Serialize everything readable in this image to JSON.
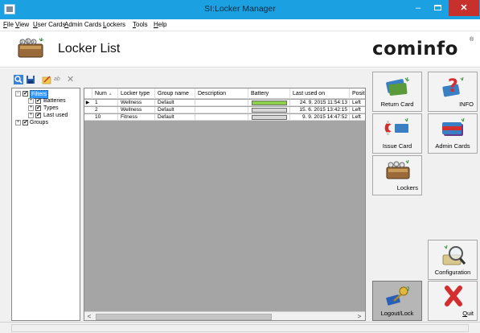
{
  "window": {
    "title": "SI:Locker Manager",
    "buttons": {
      "minimize": "–",
      "close": "✕"
    }
  },
  "menu": {
    "items": [
      "File",
      "View",
      "User Cards",
      "Admin Cards",
      "Lockers",
      "Tools",
      "Help"
    ]
  },
  "header": {
    "title": "Locker List",
    "logo": "cominfo",
    "logo_mark": "®"
  },
  "toolbar": {
    "icons": [
      "search-icon",
      "save-icon",
      "edit-icon",
      "rename-icon",
      "delete-icon"
    ],
    "rename_glyph": "ab",
    "delete_glyph": "✕"
  },
  "tree": {
    "nodes": [
      {
        "label": "Filters",
        "expander": "−",
        "selected": true
      },
      {
        "label": "Batteries",
        "expander": "+"
      },
      {
        "label": "Types",
        "expander": "+"
      },
      {
        "label": "Last used",
        "expander": "+"
      },
      {
        "label": "Groups",
        "expander": "+"
      }
    ]
  },
  "grid": {
    "columns": [
      "Num",
      "Locker type",
      "Group name",
      "Description",
      "Battery",
      "Last used on",
      "Positi"
    ],
    "sort_glyph": "▲",
    "current_row_marker": "▶",
    "rows": [
      {
        "num": "1",
        "type": "Wellness",
        "group": "Default",
        "description": "",
        "battery_level": 1.0,
        "last_used": "24. 9. 2015 11:54:13",
        "position": "Left"
      },
      {
        "num": "2",
        "type": "Wellness",
        "group": "Default",
        "description": "",
        "battery_level": 0.0,
        "last_used": "15. 6. 2015 13:42:15",
        "position": "Left"
      },
      {
        "num": "10",
        "type": "Fitness",
        "group": "Default",
        "description": "",
        "battery_level": 0.0,
        "last_used": "9. 9. 2015 14:47:52",
        "position": "Left"
      }
    ],
    "scroll_left": "<",
    "scroll_right": ">"
  },
  "side_buttons": {
    "return_card": "Return Card",
    "info": "INFO",
    "issue_card": "Issue Card",
    "admin_cards": "Admin Cards",
    "lockers": "Lockers",
    "configuration": "Configuration",
    "logout": "Logout/Lock",
    "quit": "Quit"
  },
  "colors": {
    "titlebar": "#1ba1e2",
    "close_button": "#c7312d",
    "battery_full": "#8dd14a",
    "grid_empty_area": "#a5a5a5",
    "selection": "#3399ff"
  }
}
